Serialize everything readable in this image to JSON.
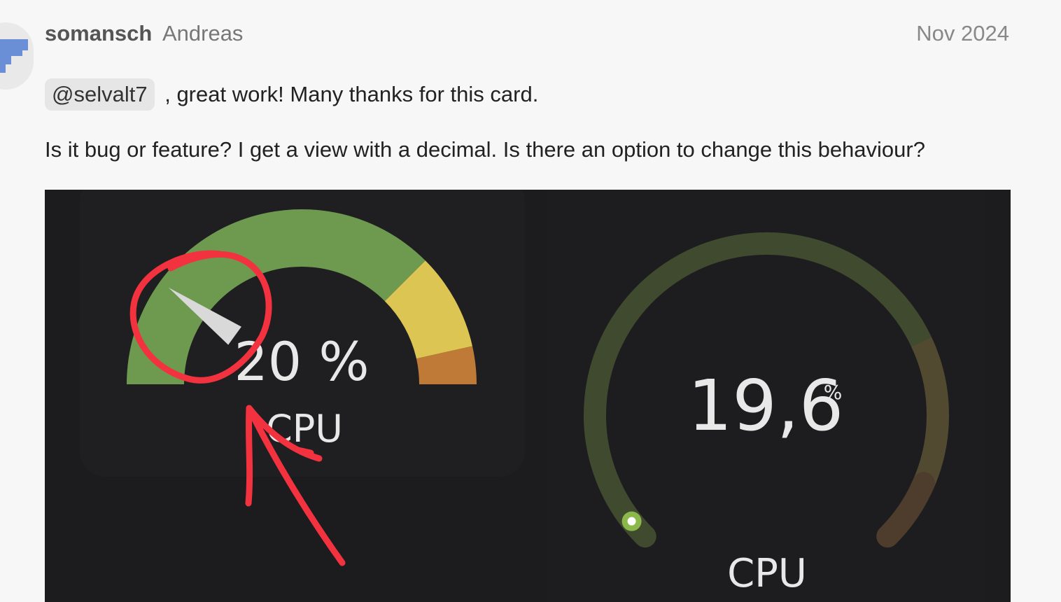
{
  "post": {
    "username": "somansch",
    "full_name": "Andreas",
    "date": "Nov 2024",
    "mention": "@selvalt7",
    "line1_rest": ", great work! Many thanks for this card.",
    "line2": "Is it bug or feature? I get a view with a decimal. Is there an option to change this behaviour?"
  },
  "image": {
    "left_gauge": {
      "value": 20,
      "value_text": "20 %",
      "label": "CPU",
      "min": 0,
      "max": 100,
      "segments": [
        {
          "from": 0,
          "to": 75,
          "color": "#6e9a50"
        },
        {
          "from": 75,
          "to": 93,
          "color": "#dcc552"
        },
        {
          "from": 93,
          "to": 100,
          "color": "#c07a38"
        }
      ],
      "needle_color": "#d9d9d9"
    },
    "right_gauge": {
      "value": 19.6,
      "value_text": "19,6",
      "unit": "%",
      "label": "CPU",
      "min": 0,
      "max": 100,
      "track_color": "#3f4a2e",
      "indicator_color": "#8ab84a"
    },
    "annotation_color": "#f2323f"
  }
}
